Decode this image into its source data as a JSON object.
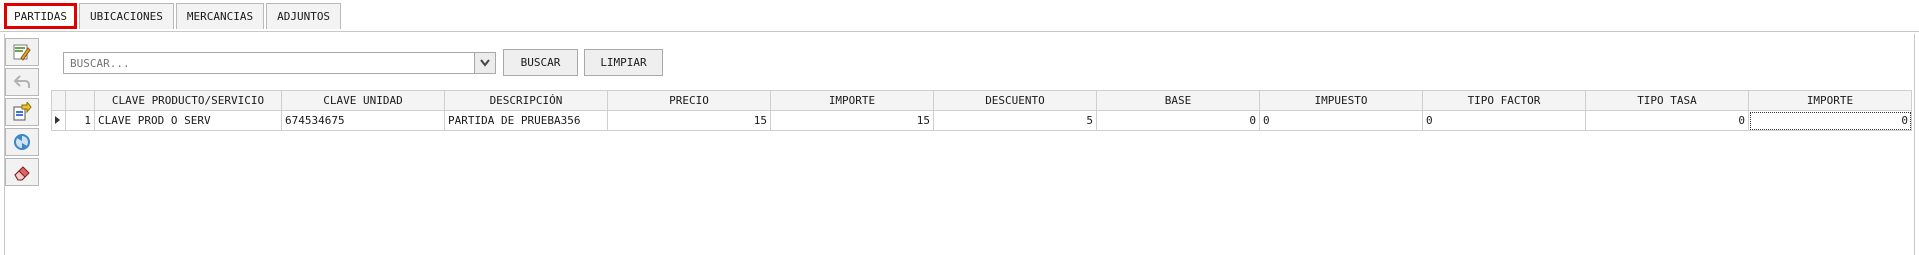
{
  "tabs": [
    {
      "label": "PARTIDAS",
      "active": true
    },
    {
      "label": "UBICACIONES",
      "active": false
    },
    {
      "label": "MERCANCIAS",
      "active": false
    },
    {
      "label": "ADJUNTOS",
      "active": false
    }
  ],
  "toolbar": {
    "icons": [
      "edit-icon",
      "undo-icon",
      "export-icon",
      "refresh-icon",
      "eraser-icon"
    ]
  },
  "search": {
    "value": "BUSCAR...",
    "placeholder": "BUSCAR..."
  },
  "buttons": {
    "search_label": "BUSCAR",
    "clear_label": "LIMPIAR"
  },
  "table": {
    "columns": [
      "CLAVE PRODUCTO/SERVICIO",
      "CLAVE UNIDAD",
      "DESCRIPCIÓN",
      "PRECIO",
      "IMPORTE",
      "DESCUENTO",
      "BASE",
      "IMPUESTO",
      "TIPO FACTOR",
      "TIPO TASA",
      "IMPORTE"
    ],
    "rows": [
      {
        "num": "1",
        "cells": [
          "CLAVE PROD O SERV",
          "674534675",
          "PARTIDA DE PRUEBA356",
          "15",
          "15",
          "5",
          "0",
          "0",
          "0",
          "0",
          "0"
        ]
      }
    ]
  },
  "colors": {
    "active_tab_border": "#e00000"
  }
}
